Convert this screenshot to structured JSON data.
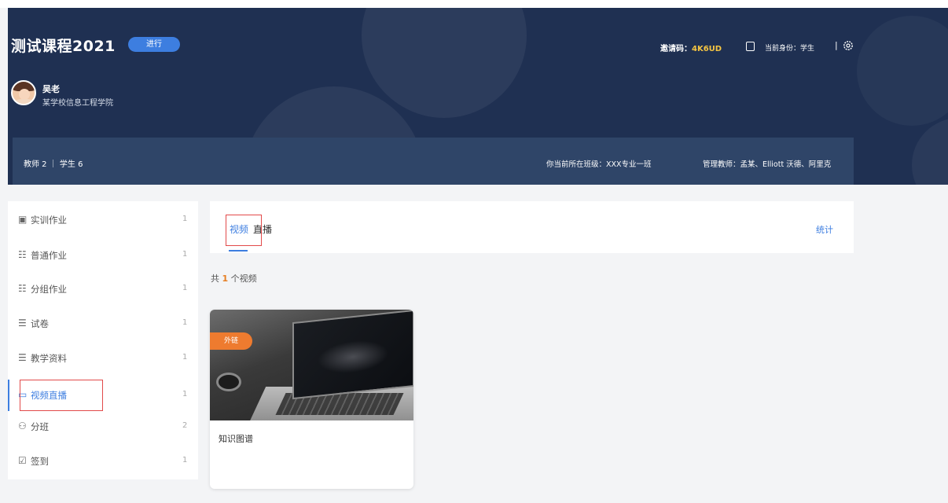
{
  "course": {
    "title": "测试课程2021",
    "status": "进行",
    "teacher_name": "吴老",
    "teacher_org": "某学校信息工程学院",
    "invite_label": "邀请码：",
    "invite_code": "4K6UD",
    "role_text": "当前身份：学生",
    "role_sep": "|",
    "counts": "教师 2 ｜ 学生 6",
    "class_info": "你当前所在班级：XXX专业一班",
    "admin_info": "管理教师：孟某、Elliott 沃德、阿里克"
  },
  "sidebar": {
    "items": [
      {
        "label": "实训作业",
        "count": "1",
        "icon": "▣"
      },
      {
        "label": "普通作业",
        "count": "1",
        "icon": "☷"
      },
      {
        "label": "分组作业",
        "count": "1",
        "icon": "☷"
      },
      {
        "label": "试卷",
        "count": "1",
        "icon": "☰"
      },
      {
        "label": "教学资料",
        "count": "1",
        "icon": "☰"
      },
      {
        "label": "视频直播",
        "count": "1",
        "icon": "▭"
      },
      {
        "label": "分班",
        "count": "2",
        "icon": "⚇"
      },
      {
        "label": "签到",
        "count": "1",
        "icon": "☑"
      }
    ]
  },
  "tabs": {
    "video": "视频",
    "live": "直播",
    "stats": "统计"
  },
  "summary": {
    "prefix": "共",
    "count": "1",
    "suffix": "个视频"
  },
  "video": {
    "badge": "外链",
    "title": "知识图谱"
  },
  "colors": {
    "header_bg": "#1f3052",
    "accent": "#3d7ee0",
    "badge": "#ee7b2f",
    "highlight": "#e24a4a"
  }
}
